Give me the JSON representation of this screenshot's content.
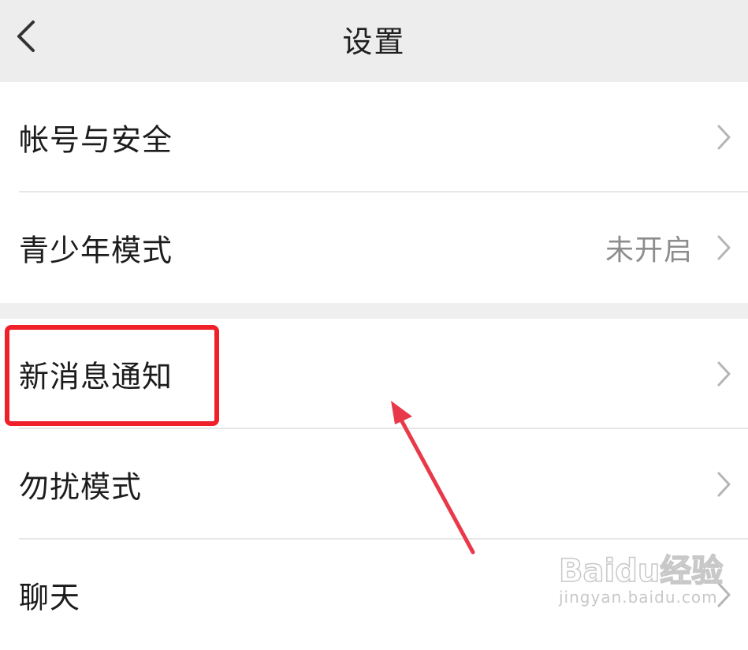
{
  "header": {
    "title": "设置"
  },
  "group1": {
    "items": [
      {
        "label": "帐号与安全",
        "value": ""
      },
      {
        "label": "青少年模式",
        "value": "未开启"
      }
    ]
  },
  "group2": {
    "items": [
      {
        "label": "新消息通知",
        "value": ""
      },
      {
        "label": "勿扰模式",
        "value": ""
      },
      {
        "label": "聊天",
        "value": ""
      }
    ]
  },
  "annotation": {
    "highlight_color": "#f0202a",
    "arrow_color": "#e8394a"
  },
  "watermark": {
    "brand": "Baidu经验",
    "site": "jingyan.baidu.com"
  }
}
